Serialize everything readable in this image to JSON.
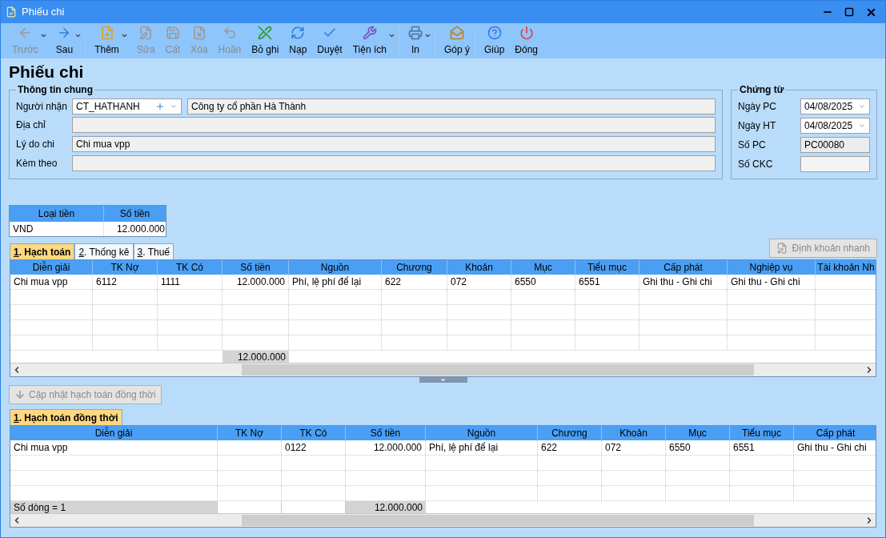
{
  "window": {
    "title": "Phiếu chi"
  },
  "toolbar": [
    {
      "label": "Trước",
      "disabled": true,
      "dropdown": true,
      "separator_after": false
    },
    {
      "label": "Sau",
      "disabled": false,
      "dropdown": true,
      "separator_after": true
    },
    {
      "label": "Thêm",
      "disabled": false,
      "dropdown": true,
      "separator_after": false
    },
    {
      "label": "Sửa",
      "disabled": true,
      "dropdown": false,
      "separator_after": false
    },
    {
      "label": "Cất",
      "disabled": true,
      "dropdown": false,
      "separator_after": false
    },
    {
      "label": "Xóa",
      "disabled": true,
      "dropdown": false,
      "separator_after": false
    },
    {
      "label": "Hoãn",
      "disabled": true,
      "dropdown": false,
      "separator_after": false
    },
    {
      "label": "Bỏ ghi",
      "disabled": false,
      "dropdown": false,
      "separator_after": false
    },
    {
      "label": "Nạp",
      "disabled": false,
      "dropdown": false,
      "separator_after": false
    },
    {
      "label": "Duyệt",
      "disabled": false,
      "dropdown": false,
      "separator_after": false
    },
    {
      "label": "Tiện ích",
      "disabled": false,
      "dropdown": true,
      "separator_after": true
    },
    {
      "label": "In",
      "disabled": false,
      "dropdown": true,
      "separator_after": true
    },
    {
      "label": "Góp ý",
      "disabled": false,
      "dropdown": false,
      "separator_after": true
    },
    {
      "label": "Giúp",
      "disabled": false,
      "dropdown": false,
      "separator_after": false
    },
    {
      "label": "Đóng",
      "disabled": false,
      "dropdown": false,
      "separator_after": false
    }
  ],
  "heading": "Phiếu chi",
  "general": {
    "title": "Thông tin chung",
    "recipient": {
      "label": "Người nhận",
      "code": "CT_HATHANH",
      "name": "Công ty cổ phần Hà Thành"
    },
    "fields": [
      {
        "label": "Địa chỉ"
      },
      {
        "label": "Lý do chi",
        "value": "Chi mua vpp"
      },
      {
        "label": "Kèm theo"
      }
    ]
  },
  "voucher": {
    "title": "Chứng từ",
    "fields": [
      {
        "label": "Ngày PC",
        "value": "04/08/2025",
        "kind": "date"
      },
      {
        "label": "Ngày HT",
        "value": "04/08/2025",
        "kind": "date"
      },
      {
        "label": "Số PC",
        "value": "PC00080",
        "kind": "readonly"
      },
      {
        "label": "Số CKC",
        "kind": "text"
      }
    ]
  },
  "currency_table": {
    "columns": [
      "Loại tiền",
      "Số tiền"
    ],
    "rows": [
      [
        "VND",
        "12.000.000"
      ]
    ]
  },
  "tabs": [
    {
      "key": "1",
      "label": ". Hạch toán",
      "selected": true
    },
    {
      "key": "2",
      "label": ". Thống kê",
      "selected": false
    },
    {
      "key": "3",
      "label": ". Thuế",
      "selected": false
    }
  ],
  "quick_button": {
    "label": "Định khoản nhanh",
    "disabled": true
  },
  "grid": {
    "columns": [
      {
        "label": "Diễn giải",
        "kind": "text"
      },
      {
        "label": "TK Nợ",
        "kind": "text"
      },
      {
        "label": "TK Có",
        "kind": "text"
      },
      {
        "label": "Số tiền",
        "kind": "number"
      },
      {
        "label": "Nguồn",
        "kind": "text"
      },
      {
        "label": "Chương",
        "kind": "text"
      },
      {
        "label": "Khoản",
        "kind": "text"
      },
      {
        "label": "Mục",
        "kind": "text"
      },
      {
        "label": "Tiểu mục",
        "kind": "text"
      },
      {
        "label": "Cấp phát",
        "kind": "text"
      },
      {
        "label": "Nghiệp vụ",
        "kind": "text"
      },
      {
        "label": "Tài khoản Nh",
        "kind": "text"
      }
    ],
    "rows": [
      [
        "Chi mua vpp",
        "6112",
        "1111",
        "12.000.000",
        "Phí, lệ phí để lại",
        "622",
        "072",
        "6550",
        "6551",
        "Ghi thu - Ghi chi",
        "Ghi thu - Ghi chi"
      ]
    ],
    "total": "12.000.000"
  },
  "update_button": {
    "label": "Cập nhật hạch toán đồng thời",
    "disabled": true
  },
  "tabs2": [
    {
      "key": "1",
      "label": ". Hạch toán đồng thời",
      "selected": true
    }
  ],
  "grid2": {
    "columns": [
      {
        "label": "Diễn giải",
        "kind": "text"
      },
      {
        "label": "TK Nợ",
        "kind": "text"
      },
      {
        "label": "TK Có",
        "kind": "text"
      },
      {
        "label": "Số tiền",
        "kind": "number"
      },
      {
        "label": "Nguồn",
        "kind": "text"
      },
      {
        "label": "Chương",
        "kind": "text"
      },
      {
        "label": "Khoản",
        "kind": "text"
      },
      {
        "label": "Mục",
        "kind": "text"
      },
      {
        "label": "Tiểu mục",
        "kind": "text"
      },
      {
        "label": "Cấp phát",
        "kind": "text"
      }
    ],
    "rows": [
      [
        "Chi mua vpp",
        "",
        "0122",
        "12.000.000",
        "Phí, lệ phí để lại",
        "622",
        "072",
        "6550",
        "6551",
        "Ghi thu - Ghi chi"
      ]
    ],
    "row_count": "Số dòng = 1",
    "total": "12.000.000"
  }
}
